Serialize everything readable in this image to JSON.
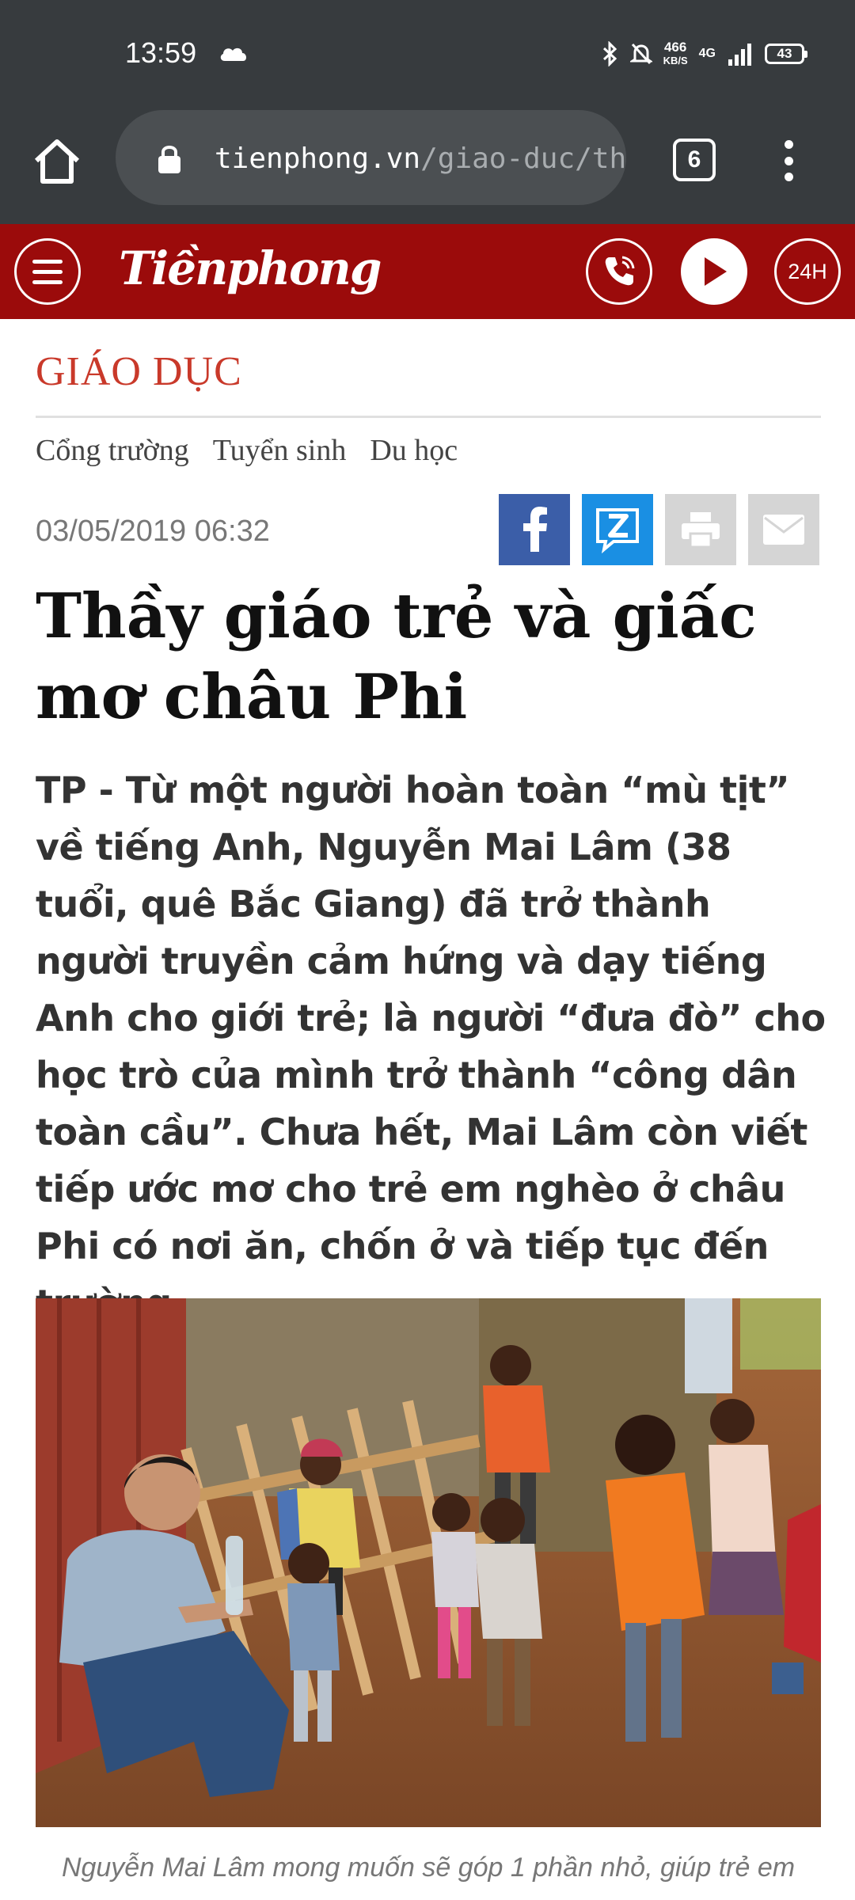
{
  "status_bar": {
    "time": "13:59",
    "net_speed_value": "466",
    "net_speed_unit": "KB/S",
    "network": "4G",
    "battery": "43",
    "icons": [
      "cloud-icon",
      "bluetooth-icon",
      "mute-icon",
      "signal-icon",
      "battery-icon"
    ]
  },
  "browser": {
    "url_host": "tienphong.vn",
    "url_path": "/giao-duc/th",
    "tab_count": "6"
  },
  "site_header": {
    "logo": "Tiềnphong",
    "live_badge": "24H",
    "brand_color": "#9b0b0b"
  },
  "article": {
    "category": "GIÁO DỤC",
    "category_color": "#c9392a",
    "subnav": [
      "Cổng trường",
      "Tuyển sinh",
      "Du học"
    ],
    "date": "03/05/2019 06:32",
    "title": "Thầy giáo trẻ và giấc mơ châu Phi",
    "sapo": "TP - Từ một người hoàn toàn “mù tịt” về tiếng Anh, Nguyễn Mai Lâm (38 tuổi, quê Bắc Giang) đã trở thành người truyền cảm hứng và dạy tiếng Anh cho giới trẻ; là người “đưa đò” cho học trò của mình trở thành “công dân toàn cầu”. Chưa hết, Mai Lâm còn viết tiếp ước mơ cho trẻ em nghèo ở châu Phi có nơi ăn, chốn ở và tiếp tục đến trường…",
    "caption": "Nguyễn Mai Lâm mong muốn sẽ góp 1 phần nhỏ, giúp trẻ em"
  }
}
